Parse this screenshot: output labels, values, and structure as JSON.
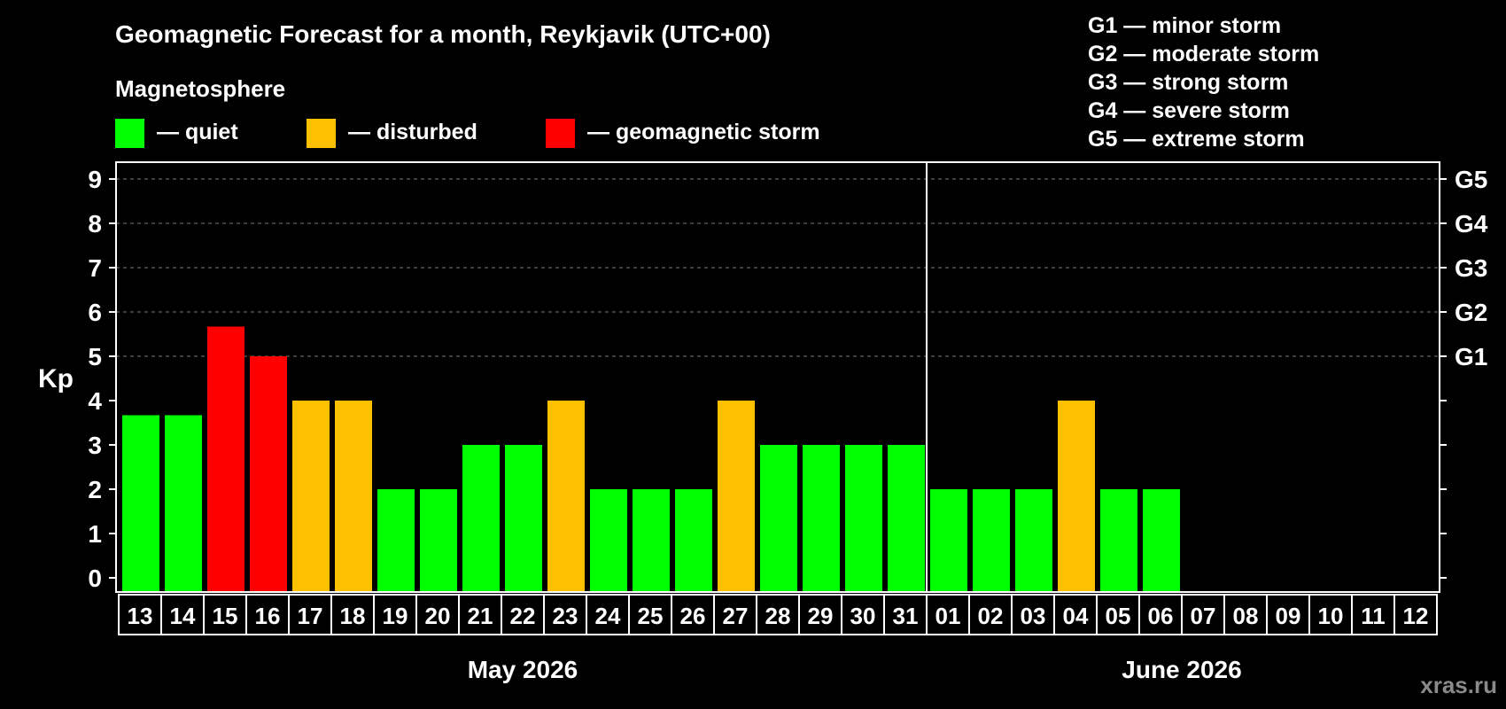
{
  "chart_data": {
    "type": "bar",
    "title": "Geomagnetic Forecast for a month, Reykjavik (UTC+00)",
    "subtitle": "Magnetosphere",
    "ylabel": "Kp",
    "ylim": [
      0,
      9
    ],
    "yticks": [
      "0",
      "1",
      "2",
      "3",
      "4",
      "5",
      "6",
      "7",
      "8",
      "9"
    ],
    "right_axis_labels": [
      {
        "kp": 5,
        "label": "G1"
      },
      {
        "kp": 6,
        "label": "G2"
      },
      {
        "kp": 7,
        "label": "G3"
      },
      {
        "kp": 8,
        "label": "G4"
      },
      {
        "kp": 9,
        "label": "G5"
      }
    ],
    "grid": "dashed horizontal at Kp 5-9",
    "legend": [
      {
        "label": "— quiet",
        "color": "#00ff00"
      },
      {
        "label": "— disturbed",
        "color": "#ffc000"
      },
      {
        "label": "— geomagnetic storm",
        "color": "#ff0000"
      }
    ],
    "storm_scale": [
      "G1 — minor storm",
      "G2 — moderate storm",
      "G3 — strong storm",
      "G4 — severe storm",
      "G5 — extreme storm"
    ],
    "categories": [
      "13",
      "14",
      "15",
      "16",
      "17",
      "18",
      "19",
      "20",
      "21",
      "22",
      "23",
      "24",
      "25",
      "26",
      "27",
      "28",
      "29",
      "30",
      "31",
      "01",
      "02",
      "03",
      "04",
      "05",
      "06",
      "07",
      "08",
      "09",
      "10",
      "11",
      "12"
    ],
    "values": [
      3.67,
      3.67,
      5.67,
      5.0,
      4,
      4,
      2,
      2,
      3,
      3,
      4,
      2,
      2,
      2,
      4,
      3,
      3,
      3,
      3,
      2,
      2,
      2,
      4,
      2,
      2,
      null,
      null,
      null,
      null,
      null,
      null
    ],
    "bar_status": [
      "quiet",
      "quiet",
      "storm",
      "storm",
      "disturbed",
      "disturbed",
      "quiet",
      "quiet",
      "quiet",
      "quiet",
      "disturbed",
      "quiet",
      "quiet",
      "quiet",
      "disturbed",
      "quiet",
      "quiet",
      "quiet",
      "quiet",
      "quiet",
      "quiet",
      "quiet",
      "disturbed",
      "quiet",
      "quiet",
      null,
      null,
      null,
      null,
      null,
      null
    ],
    "status_colors": {
      "quiet": "#00ff00",
      "disturbed": "#ffc000",
      "storm": "#ff0000"
    },
    "month_groups": [
      {
        "label": "May 2026",
        "first": 0,
        "last": 18
      },
      {
        "label": "June 2026",
        "first": 19,
        "last": 30
      }
    ]
  },
  "watermark": "xras.ru"
}
